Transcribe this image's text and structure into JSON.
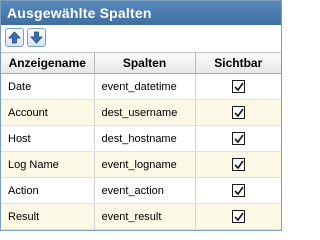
{
  "panel": {
    "title": "Ausgewählte Spalten"
  },
  "toolbar": {
    "move_up_icon": "arrow-up-icon",
    "move_down_icon": "arrow-down-icon"
  },
  "table": {
    "columns": [
      "Anzeigename",
      "Spalten",
      "Sichtbar"
    ],
    "rows": [
      {
        "display_name": "Date",
        "column": "event_datetime",
        "visible": true
      },
      {
        "display_name": "Account",
        "column": "dest_username",
        "visible": true
      },
      {
        "display_name": "Host",
        "column": "dest_hostname",
        "visible": true
      },
      {
        "display_name": "Log Name",
        "column": "event_logname",
        "visible": true
      },
      {
        "display_name": "Action",
        "column": "event_action",
        "visible": true
      },
      {
        "display_name": "Result",
        "column": "event_result",
        "visible": true
      }
    ]
  },
  "colors": {
    "title_bar": "#4a7aae",
    "border": "#7b9ebd",
    "row_alt": "#fbf8e6"
  }
}
